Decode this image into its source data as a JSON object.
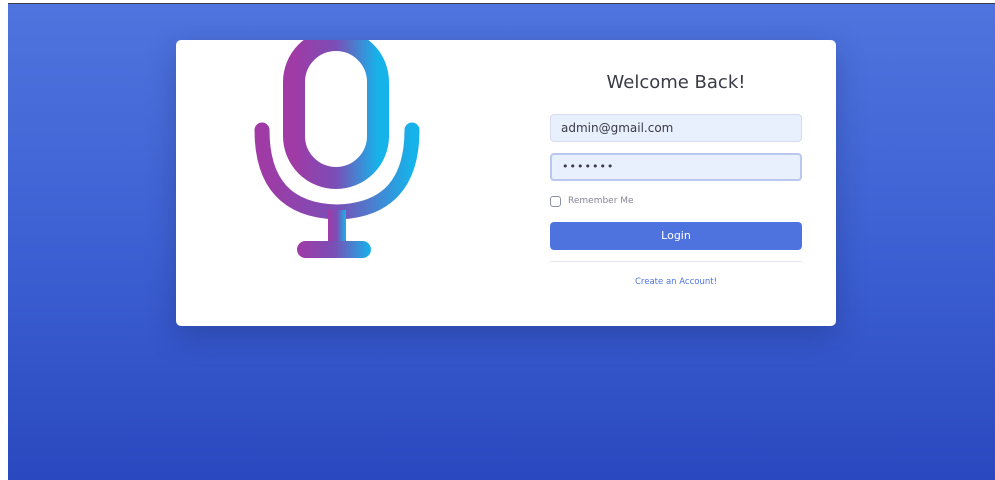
{
  "login": {
    "title": "Welcome Back!",
    "email_value": "admin@gmail.com",
    "password_masked": "•••••••",
    "remember_label": "Remember Me",
    "login_label": "Login",
    "create_account_label": "Create an Account!"
  },
  "logo": {
    "icon": "microphone-icon"
  },
  "colors": {
    "background_top": "#4f74de",
    "background_bottom": "#2a48bf",
    "primary": "#4e73df",
    "mic_gradient_start": "#9b3aa8",
    "mic_gradient_end": "#16b0e9"
  }
}
